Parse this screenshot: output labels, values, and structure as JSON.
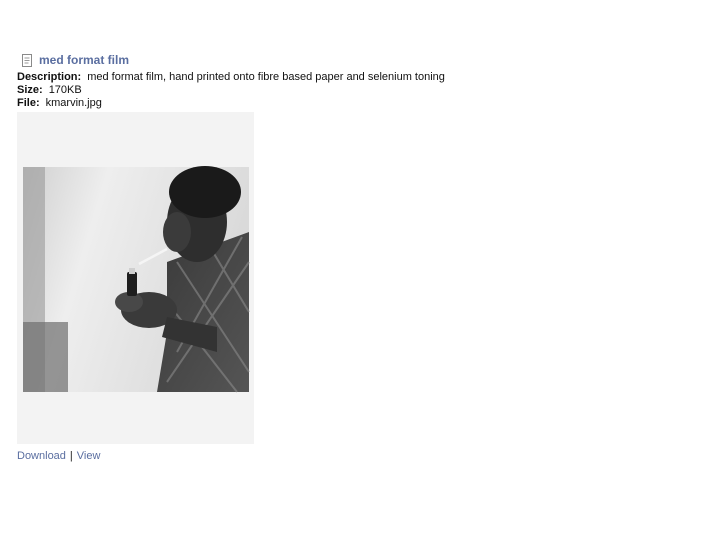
{
  "attachment": {
    "title": "med format film",
    "icon": "document-icon",
    "description_label": "Description:",
    "description": "med format film, hand printed onto fibre based paper and selenium toning",
    "size_label": "Size:",
    "size": "170KB",
    "file_label": "File:",
    "file": "kmarvin.jpg"
  },
  "links": {
    "download": "Download",
    "separator": "|",
    "view": "View"
  },
  "colors": {
    "link": "#5a6ea0"
  }
}
